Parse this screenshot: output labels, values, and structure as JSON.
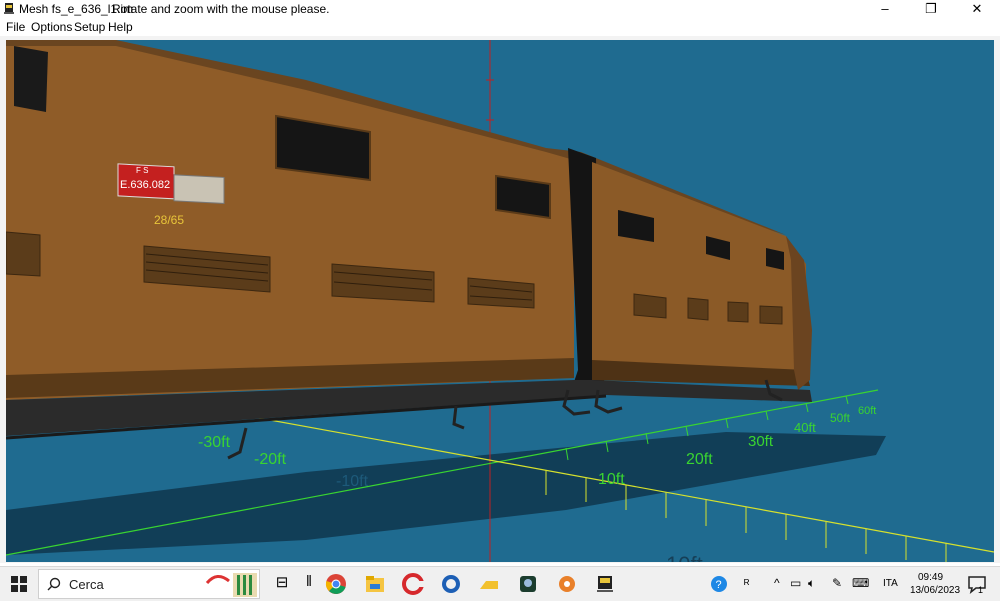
{
  "window": {
    "title": "Mesh fs_e_636_l1.im",
    "message": "Rotate and zoom with the mouse please.",
    "controls": [
      "–",
      "❐",
      "✕"
    ]
  },
  "menu": [
    "File",
    "Options",
    "Setup",
    "Help"
  ],
  "locomotive": {
    "plate": "E.636.082",
    "plate_top": "F S",
    "number": "28/65"
  },
  "axis_labels": {
    "x": [
      "-30ft",
      "-20ft",
      "-10ft",
      "10ft",
      "20ft",
      "30ft",
      "40ft",
      "50ft",
      "60ft"
    ],
    "y": [
      "10ft"
    ]
  },
  "taskbar": {
    "search_placeholder": "Cerca",
    "language": "ITA",
    "time": "09:49",
    "date": "13/06/2023",
    "notification_count": "1"
  },
  "colors": {
    "viewport_bg": "#1f6b90",
    "loco_body": "#8f5c28",
    "grid_green": "#39d431",
    "grid_yellow": "#d6e12d",
    "axis_red": "#c02020"
  }
}
